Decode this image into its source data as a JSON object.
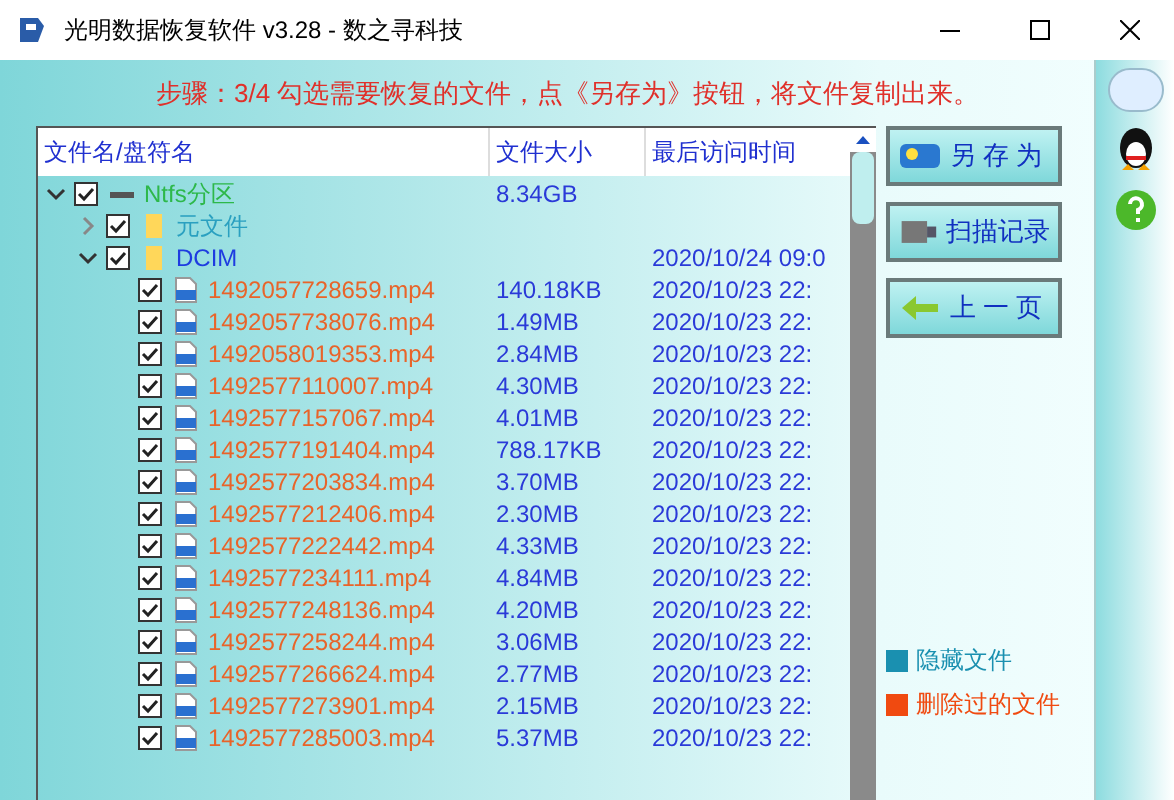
{
  "window": {
    "title": "光明数据恢复软件 v3.28 - 数之寻科技"
  },
  "step_text": "步骤：3/4 勾选需要恢复的文件，点《另存为》按钮，将文件复制出来。",
  "table": {
    "columns": [
      "文件名/盘符名",
      "文件大小",
      "最后访问时间"
    ],
    "tree": [
      {
        "kind": "drive",
        "name": "Ntfs分区",
        "size": "8.34GB",
        "checked": true,
        "expanded": true,
        "color": "#2db84a",
        "children": [
          {
            "kind": "folder",
            "name": "元文件",
            "checked": true,
            "expanded": false,
            "color": "#2aa0c0"
          },
          {
            "kind": "folder",
            "name": "DCIM",
            "time": "2020/10/24 09:0",
            "checked": true,
            "expanded": true,
            "color": "#1e3ce0",
            "children": [
              {
                "kind": "file",
                "name": "1492057728659.mp4",
                "size": "140.18KB",
                "time": "2020/10/23 22:",
                "checked": true,
                "color": "#e8642a"
              },
              {
                "kind": "file",
                "name": "1492057738076.mp4",
                "size": "1.49MB",
                "time": "2020/10/23 22:",
                "checked": true,
                "color": "#e8642a"
              },
              {
                "kind": "file",
                "name": "1492058019353.mp4",
                "size": "2.84MB",
                "time": "2020/10/23 22:",
                "checked": true,
                "color": "#e8642a"
              },
              {
                "kind": "file",
                "name": "1492577110007.mp4",
                "size": "4.30MB",
                "time": "2020/10/23 22:",
                "checked": true,
                "color": "#e8642a"
              },
              {
                "kind": "file",
                "name": "1492577157067.mp4",
                "size": "4.01MB",
                "time": "2020/10/23 22:",
                "checked": true,
                "color": "#e8642a"
              },
              {
                "kind": "file",
                "name": "1492577191404.mp4",
                "size": "788.17KB",
                "time": "2020/10/23 22:",
                "checked": true,
                "color": "#e8642a"
              },
              {
                "kind": "file",
                "name": "1492577203834.mp4",
                "size": "3.70MB",
                "time": "2020/10/23 22:",
                "checked": true,
                "color": "#e8642a"
              },
              {
                "kind": "file",
                "name": "1492577212406.mp4",
                "size": "2.30MB",
                "time": "2020/10/23 22:",
                "checked": true,
                "color": "#e8642a"
              },
              {
                "kind": "file",
                "name": "1492577222442.mp4",
                "size": "4.33MB",
                "time": "2020/10/23 22:",
                "checked": true,
                "color": "#e8642a"
              },
              {
                "kind": "file",
                "name": "1492577234111.mp4",
                "size": "4.84MB",
                "time": "2020/10/23 22:",
                "checked": true,
                "color": "#e8642a"
              },
              {
                "kind": "file",
                "name": "1492577248136.mp4",
                "size": "4.20MB",
                "time": "2020/10/23 22:",
                "checked": true,
                "color": "#e8642a"
              },
              {
                "kind": "file",
                "name": "1492577258244.mp4",
                "size": "3.06MB",
                "time": "2020/10/23 22:",
                "checked": true,
                "color": "#e8642a"
              },
              {
                "kind": "file",
                "name": "1492577266624.mp4",
                "size": "2.77MB",
                "time": "2020/10/23 22:",
                "checked": true,
                "color": "#e8642a"
              },
              {
                "kind": "file",
                "name": "1492577273901.mp4",
                "size": "2.15MB",
                "time": "2020/10/23 22:",
                "checked": true,
                "color": "#e8642a"
              },
              {
                "kind": "file",
                "name": "1492577285003.mp4",
                "size": "5.37MB",
                "time": "2020/10/23 22:",
                "checked": true,
                "color": "#e8642a"
              }
            ]
          }
        ]
      }
    ]
  },
  "buttons": [
    {
      "kind": "save",
      "label": "另 存 为"
    },
    {
      "kind": "scan",
      "label": "扫描记录"
    },
    {
      "kind": "back",
      "label": "上 一 页"
    }
  ],
  "legend": [
    {
      "label": "隐藏文件",
      "color": "#1a90b0"
    },
    {
      "label": "删除过的文件",
      "color": "#f04a10"
    }
  ]
}
